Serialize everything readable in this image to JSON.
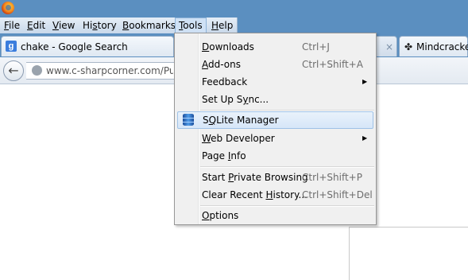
{
  "menubar": {
    "items": [
      {
        "id": "file",
        "label": "File",
        "u": "F",
        "rest": "ile"
      },
      {
        "id": "edit",
        "label": "Edit",
        "u": "E",
        "rest": "dit"
      },
      {
        "id": "view",
        "label": "View",
        "u": "V",
        "rest": "iew"
      },
      {
        "id": "history",
        "label": "History",
        "pre": "Hi",
        "u": "s",
        "rest": "tory"
      },
      {
        "id": "bookmarks",
        "label": "Bookmarks",
        "u": "B",
        "rest": "ookmarks"
      },
      {
        "id": "tools",
        "label": "Tools",
        "u": "T",
        "rest": "ools"
      },
      {
        "id": "help",
        "label": "Help",
        "u": "H",
        "rest": "elp"
      }
    ]
  },
  "tabs": {
    "tab1": {
      "label": "chake - Google Search",
      "favicon": "g"
    },
    "tab2": {
      "prefix": ".",
      "close": "×"
    },
    "tab3": {
      "label": "Mindcracker"
    }
  },
  "nav": {
    "url_text": "www.c-sharpcorner.com/Publ"
  },
  "tools_menu": {
    "downloads": {
      "u": "D",
      "rest": "ownloads",
      "shortcut": "Ctrl+J"
    },
    "addons": {
      "u": "A",
      "rest": "dd-ons",
      "shortcut": "Ctrl+Shift+A"
    },
    "feedback": {
      "label": "Feedback"
    },
    "setup_sync": {
      "pre": "Set Up S",
      "u": "y",
      "rest": "nc..."
    },
    "sqlite_manager": {
      "pre": "S",
      "u": "Q",
      "rest": "Lite Manager"
    },
    "web_developer": {
      "u": "W",
      "rest": "eb Developer"
    },
    "page_info": {
      "pre": "Page ",
      "u": "I",
      "rest": "nfo"
    },
    "private_browsing": {
      "pre": "Start ",
      "u": "P",
      "rest": "rivate Browsing",
      "shortcut": "Ctrl+Shift+P"
    },
    "clear_history": {
      "pre": "Clear Recent ",
      "u": "H",
      "rest": "istory...",
      "shortcut": "Ctrl+Shift+Del"
    },
    "options": {
      "u": "O",
      "rest": "ptions"
    }
  },
  "colors": {
    "titlebar": "#5b8fc0",
    "menu_bg": "#f0f0f0",
    "highlight_border": "#9fc2e7"
  }
}
